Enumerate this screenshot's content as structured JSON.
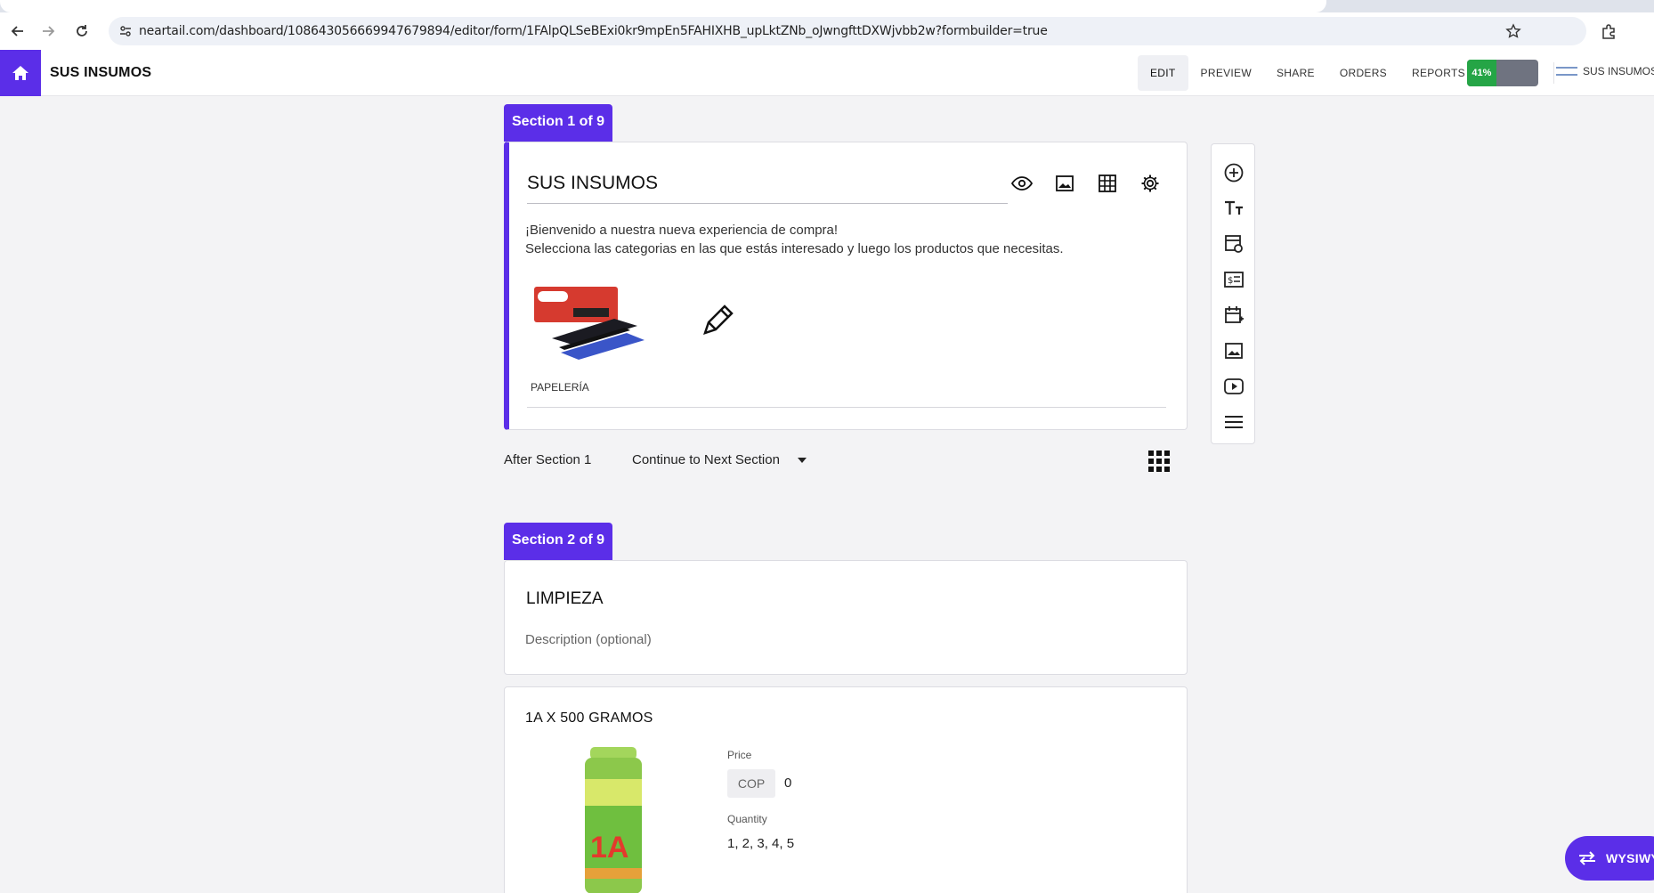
{
  "browser": {
    "url": "neartail.com/dashboard/108643056669947679894/editor/form/1FAlpQLSeBExi0kr9mpEn5FAHIXHB_upLktZNb_oJwngfttDXWjvbb2w?formbuilder=true"
  },
  "header": {
    "title": "SUS INSUMOS",
    "nav": [
      "EDIT",
      "PREVIEW",
      "SHARE",
      "ORDERS",
      "REPORTS"
    ],
    "progress_label": "41%",
    "progress_value": 0.41,
    "brand_name": "SUS INSUMOS"
  },
  "section1": {
    "tab": "Section 1 of 9",
    "title": "SUS INSUMOS",
    "description_line1": "¡Bienvenido a nuestra nueva experiencia de compra!",
    "description_line2": "Selecciona las categorias en las que estás interesado y luego los productos que necesitas.",
    "category_label": "PAPELERÍA",
    "after_label": "After Section 1",
    "after_action": "Continue to Next Section"
  },
  "section2": {
    "tab": "Section 2 of 9",
    "title": "LIMPIEZA",
    "description_placeholder": "Description (optional)"
  },
  "product": {
    "title": "1A X 500 GRAMOS",
    "price_label": "Price",
    "currency": "COP",
    "price_value": "0",
    "quantity_label": "Quantity",
    "quantity_options": "1, 2, 3, 4, 5",
    "image_brand_text": "1A"
  },
  "floating": {
    "wysiwyg_label": "WYSIWYG"
  },
  "colors": {
    "accent": "#5b2ee8",
    "progress": "#25a546"
  }
}
